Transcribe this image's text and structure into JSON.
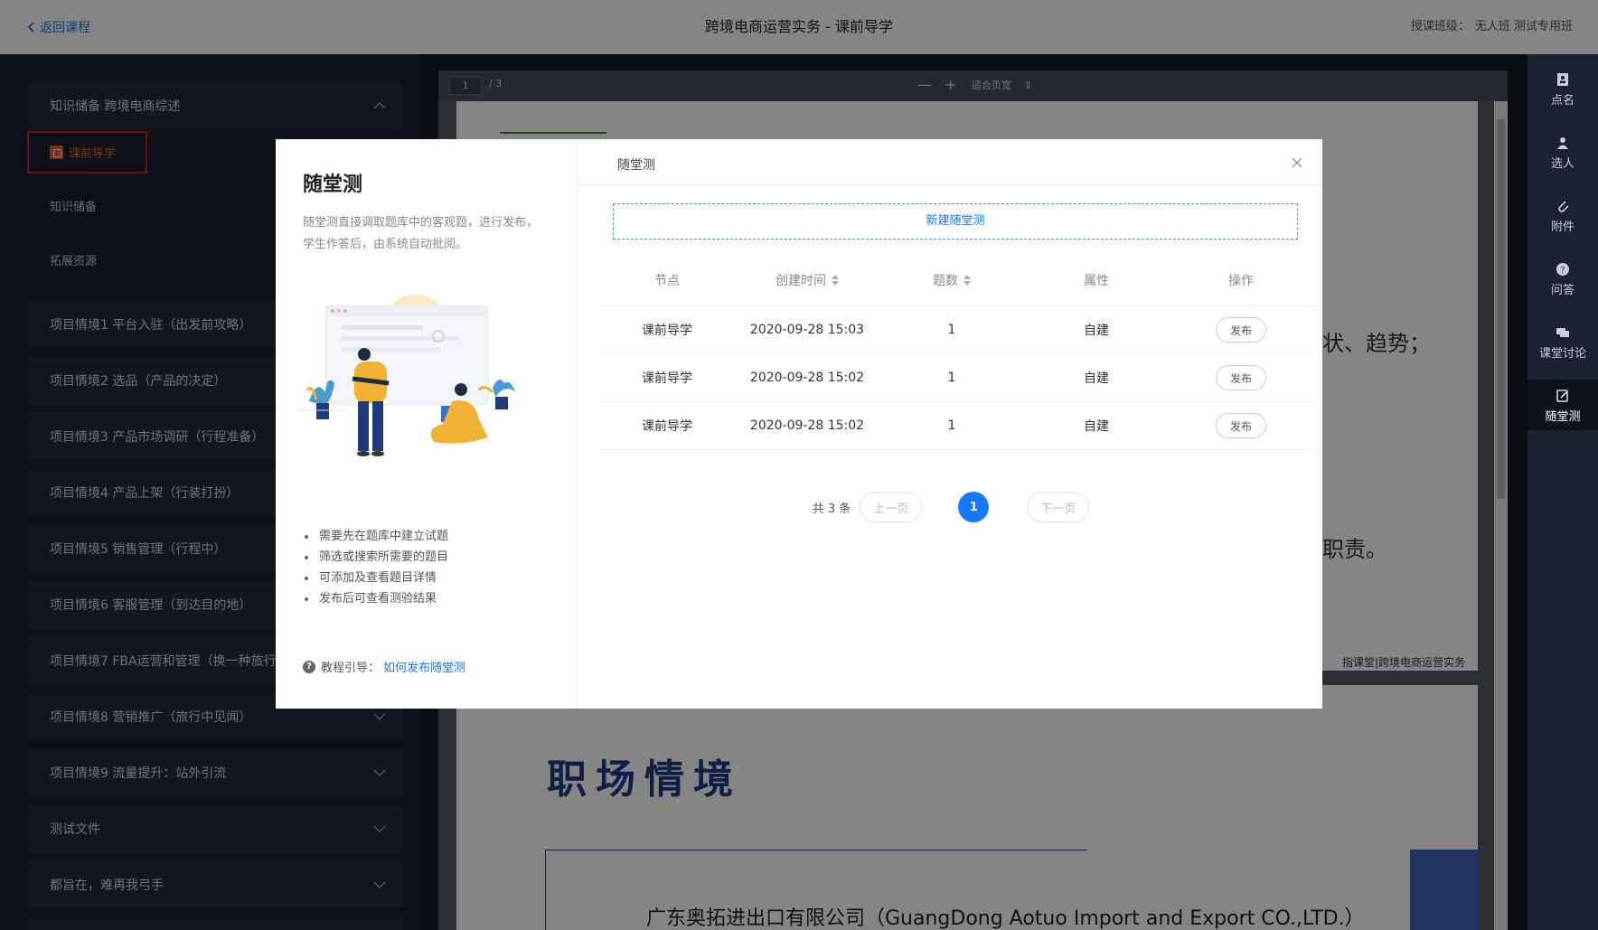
{
  "topbar": {
    "back_label": "返回课程",
    "title": "跨境电商运营实务 - 课前导学",
    "class_label": "授课班级：",
    "class_value": "无人班 测试专用班"
  },
  "sidebar": {
    "sections": [
      {
        "label": "知识储备 跨境电商综述",
        "expanded": true
      },
      {
        "label": "项目情境1 平台入驻（出发前攻略）"
      },
      {
        "label": "项目情境2 选品（产品的决定）"
      },
      {
        "label": "项目情境3 产品市场调研（行程准备）"
      },
      {
        "label": "项目情境4 产品上架（行装打扮）"
      },
      {
        "label": "项目情境5 销售管理（行程中）"
      },
      {
        "label": "项目情境6 客服管理（到达目的地）"
      },
      {
        "label": "项目情境7 FBA运营和管理（换一种旅行"
      },
      {
        "label": "项目情境8 营销推广（旅行中见闻）"
      },
      {
        "label": "项目情境9 流量提升：站外引流"
      },
      {
        "label": "测试文件"
      },
      {
        "label": "都旨在，难再我弓手"
      }
    ],
    "sub_items": [
      {
        "label": "课前导学",
        "active": true
      },
      {
        "label": "知识储备"
      },
      {
        "label": "拓展资源"
      }
    ]
  },
  "viewer": {
    "page_current": "1",
    "page_total": "/ 3",
    "zoom_minus": "—",
    "zoom_plus": "+",
    "zoom_mode": "适合页宽",
    "partial_text_1": "状、趋势；",
    "partial_text_2": "职责。",
    "footer": "指课堂|跨境电商运营实务",
    "scene_title": "职场情境",
    "company": "广东奥拓进出口有限公司（GuangDong Aotuo Import and Export CO.,LTD.）"
  },
  "right_toolbar": {
    "items": [
      {
        "label": "点名",
        "icon": "roll-call-icon"
      },
      {
        "label": "选人",
        "icon": "person-icon"
      },
      {
        "label": "附件",
        "icon": "paperclip-icon"
      },
      {
        "label": "问答",
        "icon": "question-icon"
      },
      {
        "label": "课堂讨论",
        "icon": "chat-icon"
      },
      {
        "label": "随堂测",
        "icon": "edit-icon",
        "active": true
      }
    ]
  },
  "modal": {
    "left": {
      "title": "随堂测",
      "description": "随堂测直接调取题库中的客观题，进行发布，学生作答后，由系统自动批阅。",
      "tips": [
        "需要先在题库中建立试题",
        "筛选或搜索所需要的题目",
        "可添加及查看题目详情",
        "发布后可查看测验结果"
      ],
      "guide_label": "教程引导：",
      "guide_link": "如何发布随堂测"
    },
    "right": {
      "header_title": "随堂测",
      "new_button": "新建随堂测",
      "columns": [
        "节点",
        "创建时间",
        "题数",
        "属性",
        "操作"
      ],
      "rows": [
        {
          "node": "课前导学",
          "created": "2020-09-28 15:03",
          "count": "1",
          "attr": "自建",
          "action": "发布"
        },
        {
          "node": "课前导学",
          "created": "2020-09-28 15:02",
          "count": "1",
          "attr": "自建",
          "action": "发布"
        },
        {
          "node": "课前导学",
          "created": "2020-09-28 15:02",
          "count": "1",
          "attr": "自建",
          "action": "发布"
        }
      ],
      "pager": {
        "total": "共 3 条",
        "prev": "上一页",
        "current": "1",
        "next": "下一页"
      }
    }
  },
  "colors": {
    "primary": "#1677ff",
    "active_orange": "#e46a3b",
    "highlight_red": "#e02020",
    "sidebar_bg": "#1d2230"
  }
}
